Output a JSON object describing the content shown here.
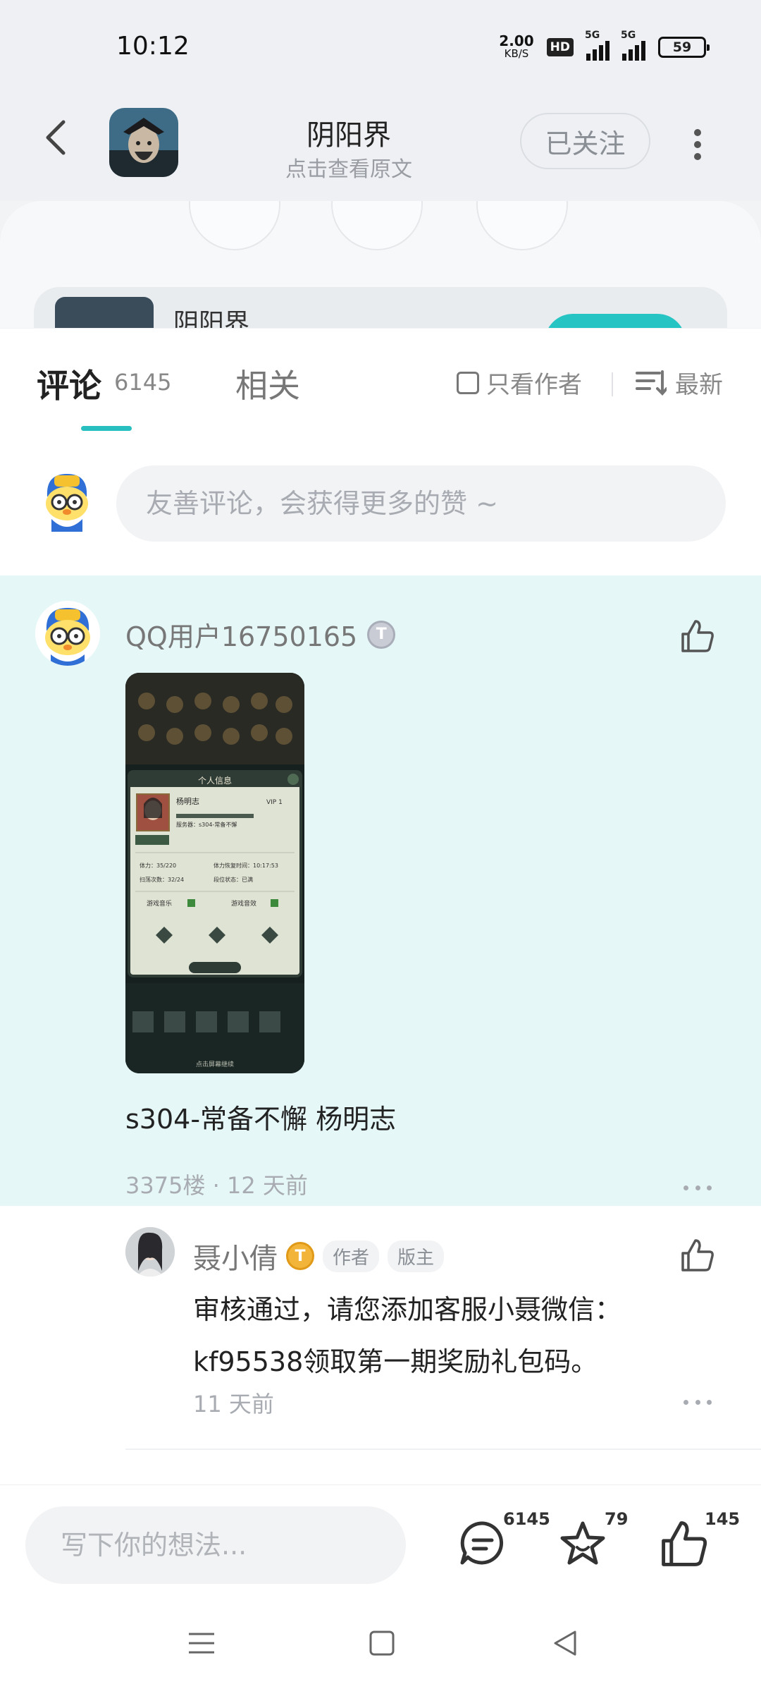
{
  "status_bar": {
    "time": "10:12",
    "net_speed_value": "2.00",
    "net_speed_unit": "KB/S",
    "hd_label": "HD",
    "sim1_label": "5G",
    "sim2_label": "5G",
    "battery": "59"
  },
  "header": {
    "title": "阴阳界",
    "subtitle": "点击查看原文",
    "follow_label": "已关注"
  },
  "peek_card": {
    "title": "阴阳界"
  },
  "tabs": {
    "comment_label": "评论",
    "comment_count": "6145",
    "related_label": "相关",
    "author_only_label": "只看作者",
    "sort_label": "最新"
  },
  "comment_input": {
    "placeholder": "友善评论，会获得更多的赞 ~"
  },
  "comment": {
    "username": "QQ用户16750165",
    "level_badge": "T",
    "text": "s304-常备不懈  杨明志",
    "floor_time": "3375楼 · 12 天前",
    "screenshot": {
      "dialog_title": "个人信息",
      "name": "杨明志",
      "vip": "VIP 1",
      "server": "服务器：s304-常备不懈",
      "row1a": "体力：35/220",
      "row1b": "体力恢复时间：10:17:53",
      "row2a": "扫荡次数：32/24",
      "row2b": "段位状态：已满",
      "music": "游戏音乐",
      "sound": "游戏音效",
      "footer": "点击屏幕继续"
    }
  },
  "reply": {
    "username": "聂小倩",
    "badge": "T",
    "tags": [
      "作者",
      "版主"
    ],
    "text": "审核通过，请您添加客服小聂微信：kf95538领取第一期奖励礼包码。",
    "time": "11 天前"
  },
  "bottom_bar": {
    "placeholder": "写下你的想法...",
    "comments_count": "6145",
    "favorites_count": "79",
    "likes_count": "145"
  },
  "colors": {
    "accent": "#27bfc0",
    "highlight_bg": "#e6f7f8",
    "muted_text": "#a8acb2"
  },
  "icons": [
    "back-icon",
    "more-icon",
    "checkbox-icon",
    "sort-icon",
    "thumb-up-icon",
    "comment-icon",
    "star-icon",
    "menu-icon",
    "home-icon",
    "back-nav-icon"
  ]
}
